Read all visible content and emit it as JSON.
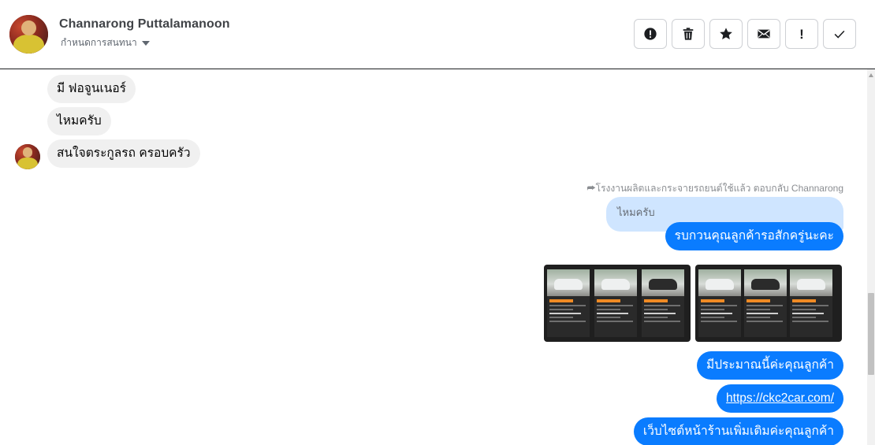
{
  "header": {
    "contact_name": "Channarong Puttalamanoon",
    "assign_label": "กำหนดการสนทนา"
  },
  "toolbar": [
    {
      "name": "report-spam-button",
      "icon": "alert-circle-icon"
    },
    {
      "name": "delete-button",
      "icon": "trash-icon"
    },
    {
      "name": "star-button",
      "icon": "star-icon"
    },
    {
      "name": "mark-unread-button",
      "icon": "envelope-icon"
    },
    {
      "name": "follow-up-button",
      "icon": "exclamation-icon",
      "glyph": "!"
    },
    {
      "name": "mark-done-button",
      "icon": "check-icon"
    }
  ],
  "messages": {
    "incoming": [
      "มี ฟอจูนเนอร์",
      "ไหมครับ",
      "สนใจตระกูลรถ ครอบครัว"
    ],
    "reply_note": "โรงงานผลิตและกระจายรถยนต์ใช้แล้ว ตอบกลับ Channarong",
    "quoted": "ไหมครับ",
    "outgoing": [
      "รบกวนคุณลูกค้ารอสักครู่นะคะ",
      "มีประมาณนี้ค่ะคุณลูกค้า",
      "https://ckc2car.com/",
      "เว็บไซต์หน้าร้านเพิ่มเติมค่ะคุณลูกค้า"
    ]
  },
  "colors": {
    "outgoing_bubble": "#0a7cff",
    "incoming_bubble": "#f0f0f0",
    "quoted_bubble": "#cfe5ff"
  }
}
